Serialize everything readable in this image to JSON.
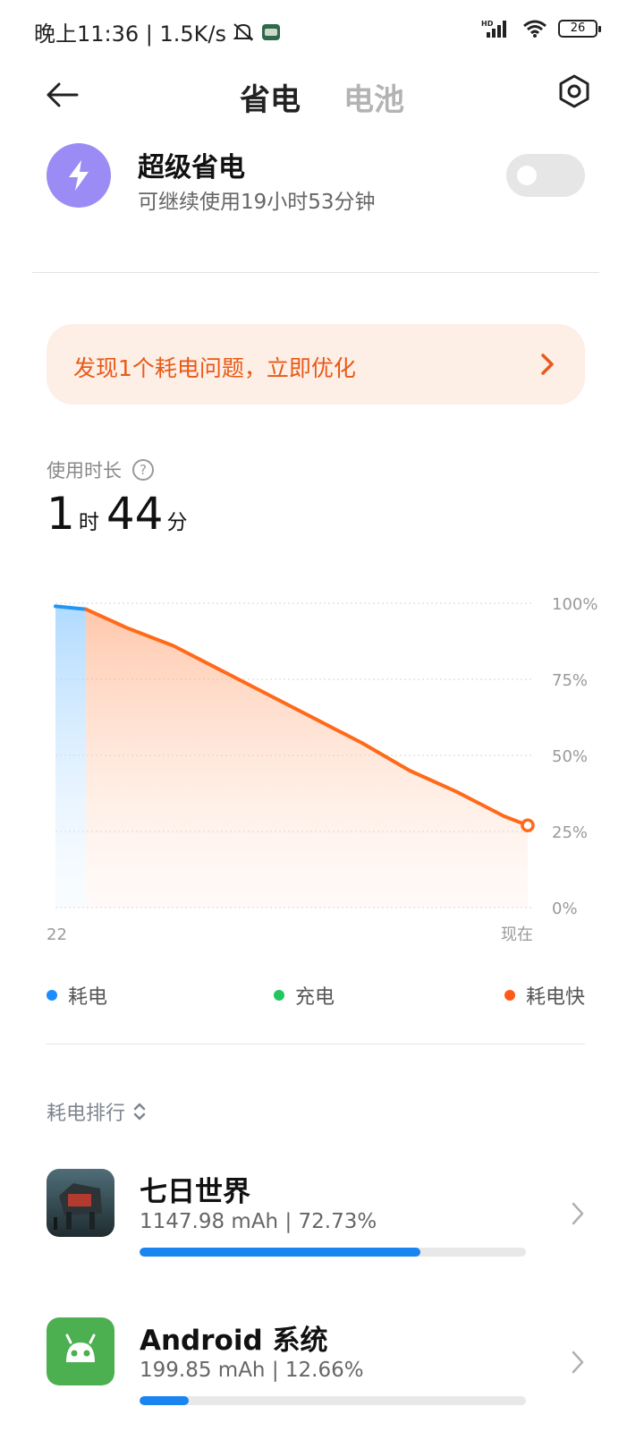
{
  "status_bar": {
    "time_text": "晚上11:36 | 1.5K/s",
    "battery": "26",
    "icons": [
      "mute-bell-icon",
      "app-notification-icon",
      "hd-signal-icon",
      "wifi-icon",
      "battery-icon"
    ]
  },
  "header": {
    "tabs": [
      {
        "label": "省电",
        "active": true
      },
      {
        "label": "电池",
        "active": false
      }
    ],
    "back_icon": "back-arrow-icon",
    "settings_icon": "settings-hexagon-icon"
  },
  "super_saver": {
    "title": "超级省电",
    "subtitle": "可继续使用19小时53分钟",
    "enabled": false,
    "icon": "lightning-icon",
    "icon_color": "#9a8cf4"
  },
  "issue_banner": {
    "text": "发现1个耗电问题，立即优化",
    "color": "#e85a17"
  },
  "usage": {
    "label": "使用时长",
    "hours": "1",
    "hours_unit": "时",
    "minutes": "44",
    "minutes_unit": "分"
  },
  "chart_data": {
    "type": "area",
    "y_ticks": [
      "100%",
      "75%",
      "50%",
      "25%",
      "0%"
    ],
    "ylim": [
      0,
      100
    ],
    "x_start_label": "22",
    "x_end_label": "现在",
    "series": [
      {
        "name": "耗电",
        "color": "#2196f3",
        "x": [
          0,
          6.5
        ],
        "values": [
          99,
          98
        ]
      },
      {
        "name": "耗电快",
        "color": "#ff6a1a",
        "x": [
          6.5,
          15,
          25,
          35,
          45,
          55,
          65,
          75,
          85,
          95,
          100
        ],
        "values": [
          98,
          92,
          86,
          78,
          70,
          62,
          54,
          45,
          38,
          30,
          27
        ]
      }
    ],
    "grid": true,
    "legend": [
      {
        "label": "耗电",
        "color": "#1a8cff"
      },
      {
        "label": "充电",
        "color": "#22c55e"
      },
      {
        "label": "耗电快",
        "color": "#ff5a1a"
      }
    ]
  },
  "ranking": {
    "label": "耗电排行"
  },
  "apps": [
    {
      "name": "七日世界",
      "stats": "1147.98 mAh | 72.73%",
      "percent": 72.73
    },
    {
      "name": "Android 系统",
      "stats": "199.85 mAh | 12.66%",
      "percent": 12.66
    }
  ]
}
